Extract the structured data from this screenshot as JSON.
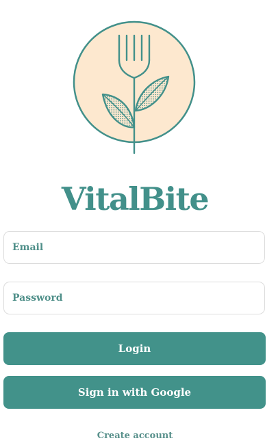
{
  "app": {
    "title": "VitalBite",
    "logo_icon": "fork-plant-icon"
  },
  "form": {
    "email_placeholder": "Email",
    "email_value": "",
    "password_placeholder": "Password",
    "password_value": ""
  },
  "buttons": {
    "login_label": "Login",
    "google_label": "Sign in with Google"
  },
  "links": {
    "create_account_label": "Create account"
  },
  "colors": {
    "accent": "#42908a",
    "button": "#42928a",
    "logo_fill": "#fde8cf",
    "field_border": "#dcdcdc"
  }
}
